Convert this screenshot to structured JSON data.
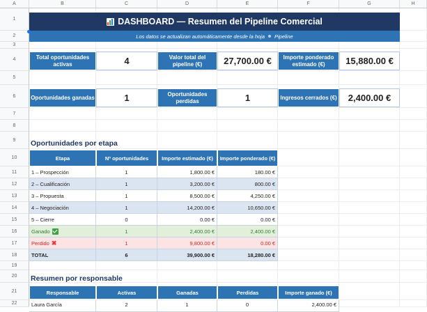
{
  "columns": [
    "A",
    "B",
    "C",
    "D",
    "E",
    "F",
    "G",
    "H"
  ],
  "rows": [
    "1",
    "2",
    "3",
    "4",
    "5",
    "6",
    "7",
    "8",
    "9",
    "10",
    "11",
    "12",
    "13",
    "14",
    "15",
    "16",
    "17",
    "18",
    "19",
    "20",
    "21",
    "22"
  ],
  "banner": {
    "title": "DASHBOARD — Resumen del Pipeline Comercial",
    "icon": "bar-chart-icon"
  },
  "subtitle": {
    "text": "Los datos se actualizan automáticamente desde la hoja",
    "link": "Pipeline"
  },
  "kpis_row1": [
    {
      "label": "Total oportunidades activas",
      "value": "4"
    },
    {
      "label": "Valor total del pipeline (€)",
      "value": "27,700.00 €"
    },
    {
      "label": "Importe ponderado estimado (€)",
      "value": "15,880.00 €"
    }
  ],
  "kpis_row2": [
    {
      "label": "Oportunidades ganadas",
      "value": "1"
    },
    {
      "label": "Oportunidades perdidas",
      "value": "1"
    },
    {
      "label": "Ingresos cerrados (€)",
      "value": "2,400.00 €"
    }
  ],
  "stage_section": {
    "title": "Oportunidades por etapa",
    "headers": [
      "Etapa",
      "Nº oportunidades",
      "Importe estimado (€)",
      "Importe ponderado (€)"
    ],
    "rows": [
      {
        "stage": "1 – Prospección",
        "count": "1",
        "estimated": "1,800.00 €",
        "weighted": "180.00 €",
        "style": "white"
      },
      {
        "stage": "2 – Cualificación",
        "count": "1",
        "estimated": "3,200.00 €",
        "weighted": "800.00 €",
        "style": "blue"
      },
      {
        "stage": "3 – Propuesta",
        "count": "1",
        "estimated": "8,500.00 €",
        "weighted": "4,250.00 €",
        "style": "white"
      },
      {
        "stage": "4 – Negociación",
        "count": "1",
        "estimated": "14,200.00 €",
        "weighted": "10,650.00 €",
        "style": "blue"
      },
      {
        "stage": "5 – Cierre",
        "count": "0",
        "estimated": "0.00 €",
        "weighted": "0.00 €",
        "style": "white"
      },
      {
        "stage": "Ganado",
        "count": "1",
        "estimated": "2,400.00 €",
        "weighted": "2,400.00 €",
        "style": "green",
        "icon": "check-icon"
      },
      {
        "stage": "Perdido",
        "count": "1",
        "estimated": "9,800.00 €",
        "weighted": "0.00 €",
        "style": "red",
        "icon": "cross-icon"
      },
      {
        "stage": "TOTAL",
        "count": "6",
        "estimated": "39,900.00 €",
        "weighted": "18,280.00 €",
        "style": "total"
      }
    ]
  },
  "owner_section": {
    "title": "Resumen por responsable",
    "headers": [
      "Responsable",
      "Activas",
      "Ganadas",
      "Perdidas",
      "Importe ganado (€)"
    ],
    "rows": [
      {
        "owner": "Laura García",
        "active": "2",
        "won": "1",
        "lost": "0",
        "won_amount": "2,400.00 €"
      }
    ]
  },
  "colors": {
    "banner": "#1f3864",
    "accent": "#2e74b5",
    "row_alt": "#dbe5f1",
    "won": "#e2efda",
    "lost": "#fce4e4"
  }
}
